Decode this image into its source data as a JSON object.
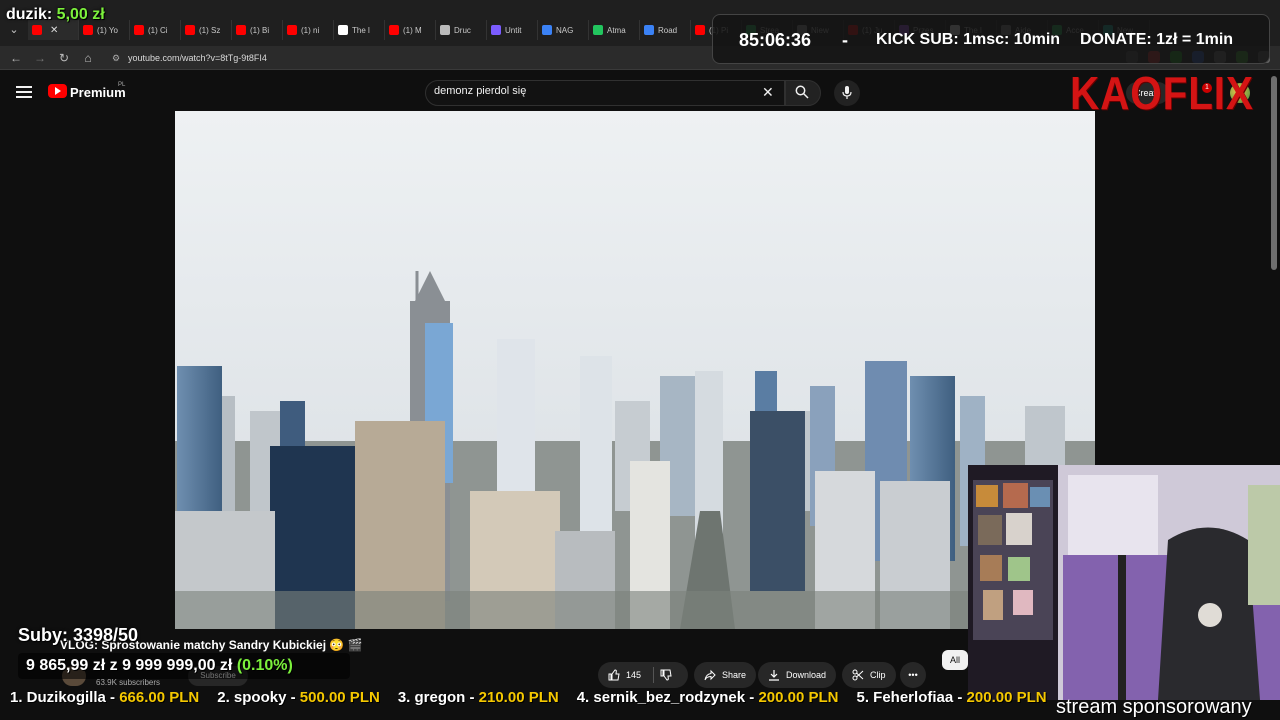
{
  "browser": {
    "tabs": [
      {
        "label": "",
        "color": "#ff0000",
        "active": true
      },
      {
        "label": "(1) Yo",
        "color": "#ff0000"
      },
      {
        "label": "(1) Ci",
        "color": "#ff0000"
      },
      {
        "label": "(1) Sz",
        "color": "#ff0000"
      },
      {
        "label": "(1) Bi",
        "color": "#ff0000"
      },
      {
        "label": "(1) ni",
        "color": "#ff0000"
      },
      {
        "label": "The l",
        "color": "#ffffff"
      },
      {
        "label": "(1) M",
        "color": "#ff0000"
      },
      {
        "label": "Druc",
        "color": "#bbbbbb"
      },
      {
        "label": "Untit",
        "color": "#7b5cff"
      },
      {
        "label": "NAG",
        "color": "#3b82f6"
      },
      {
        "label": "Atma",
        "color": "#22c55e"
      },
      {
        "label": "Road",
        "color": "#3b82f6"
      },
      {
        "label": "(1) Pi",
        "color": "#ff0000"
      },
      {
        "label": "Strea",
        "color": "#22c55e"
      },
      {
        "label": "Niew",
        "color": "#999999"
      },
      {
        "label": "(1) Ju",
        "color": "#ff0000"
      },
      {
        "label": "Przes",
        "color": "#a855f7"
      },
      {
        "label": "The l",
        "color": "#ffffff"
      },
      {
        "label": "Aide",
        "color": "#888888"
      },
      {
        "label": "Acce",
        "color": "#22c55e"
      },
      {
        "label": "New",
        "color": "#14b8a6"
      }
    ],
    "url": "youtube.com/watch?v=8tTg-9t8FI4"
  },
  "overlay": {
    "top_donor_name": "duzik:",
    "top_donor_amount": "5,00 zł",
    "timer": "85:06:36",
    "dash": "-",
    "kick_sub": "KICK SUB: 1msc: 10min",
    "donate": "DONATE: 1zł = 1min",
    "kaoflix": "KAOFLIX",
    "suby": "Suby: 3398/50",
    "goal_text": "9 865,99 zł  z  9 999 999,00 zł",
    "goal_pct": "(0.10%)",
    "sponsored": "stream sponsorowany",
    "ticker": [
      {
        "label": "1. Duzikogilla -",
        "amount": "666.00 PLN"
      },
      {
        "label": "2. spooky -",
        "amount": "500.00 PLN"
      },
      {
        "label": "3. gregon -",
        "amount": "210.00 PLN"
      },
      {
        "label": "4. sernik_bez_rodzynek -",
        "amount": "200.00 PLN"
      },
      {
        "label": "5. Feherlofiaa -",
        "amount": "200.00 PLN"
      }
    ]
  },
  "youtube": {
    "brand": "Premium",
    "region": "PL",
    "search_query": "demonz pierdol się",
    "create_label": "Create",
    "notif_count": "1",
    "video_title": "VLOG: Sprostowanie matchy Sandry Kubickiej 😳 🎬",
    "subscribers": "63.9K subscribers",
    "subscribe_label": "Subscribe",
    "likes": "145",
    "share_label": "Share",
    "download_label": "Download",
    "clip_label": "Clip",
    "more_label": "•••",
    "chip_all": "All"
  },
  "colors": {
    "accent_green": "#7cf13c",
    "ticker_amount": "#f5c800",
    "youtube_red": "#ff0000",
    "kaoflix_red": "#d41414"
  }
}
